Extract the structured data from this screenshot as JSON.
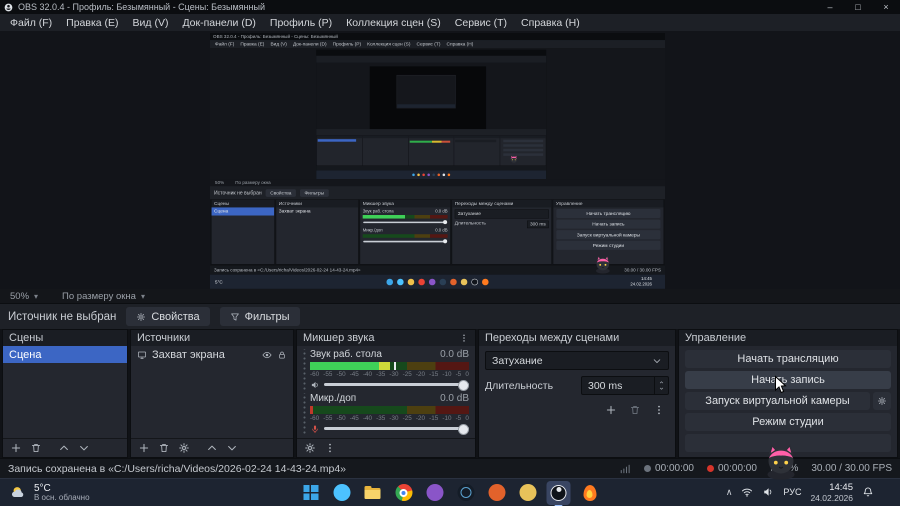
{
  "window": {
    "title": "OBS 32.0.4 - Профиль: Безымянный - Сцены: Безымянный",
    "controls": {
      "minimize": "–",
      "maximize": "□",
      "close": "×"
    }
  },
  "menu": {
    "items": [
      "Файл (F)",
      "Правка (E)",
      "Вид (V)",
      "Док-панели (D)",
      "Профиль (P)",
      "Коллекция сцен (S)",
      "Сервис (T)",
      "Справка (H)"
    ]
  },
  "preview": {
    "zoom": "50%",
    "fit": "По размеру окна"
  },
  "source_row": {
    "status": "Источник не выбран",
    "properties": "Свойства",
    "filters": "Фильтры"
  },
  "scenes": {
    "title": "Сцены",
    "items": [
      {
        "label": "Сцена",
        "selected": true
      }
    ]
  },
  "sources": {
    "title": "Источники",
    "items": [
      {
        "label": "Захват экрана"
      }
    ]
  },
  "mixer": {
    "title": "Микшер звука",
    "channels": [
      {
        "label": "Звук раб. стола",
        "db": "0.0 dB"
      },
      {
        "label": "Микр./доп",
        "db": "0.0 dB"
      }
    ],
    "ticks": [
      "-60",
      "-55",
      "-50",
      "-45",
      "-40",
      "-35",
      "-30",
      "-25",
      "-20",
      "-15",
      "-10",
      "-5",
      "0"
    ]
  },
  "transitions": {
    "title": "Переходы между сценами",
    "selected": "Затухание",
    "duration_label": "Длительность",
    "duration": "300 ms"
  },
  "controls": {
    "title": "Управление",
    "start_stream": "Начать трансляцию",
    "start_record": "Начать запись",
    "virtual_camera": "Запуск виртуальной камеры",
    "studio_mode": "Режим студии",
    "extra_label": ""
  },
  "status": {
    "message": "Запись сохранена в «C:/Users/richa/Videos/2026-02-24 14-43-24.mp4»",
    "stream_time": "00:00:00",
    "record_time": "00:00:00",
    "cpu": "1%",
    "fps": "30.00 / 30.00 FPS"
  },
  "taskbar": {
    "weather_temp": "5°C",
    "weather_desc": "В осн. облачно",
    "language": "РУС",
    "time": "14:45",
    "date": "24.02.2026",
    "pinned_icons": [
      "start",
      "widgets",
      "explorer",
      "chrome",
      "purple-app",
      "steam",
      "orange-app",
      "yellow-app",
      "obs",
      "flame-app"
    ]
  },
  "icons": {
    "properties": "gear-icon",
    "filters": "funnel-icon",
    "add": "plus-icon",
    "remove": "trash-icon",
    "move_up": "chevron-up-icon",
    "move_down": "chevron-down-icon",
    "visibility": "eye-icon",
    "lock": "lock-icon",
    "source_type": "display-icon",
    "volume": "speaker-icon",
    "mic": "microphone-icon",
    "more": "vertical-dots-icon"
  },
  "colors": {
    "selection_blue": "#3c66c4",
    "meter_green": "#3fd158",
    "meter_yellow": "#e6c229",
    "meter_red": "#e0523d",
    "record_red": "#d6342a",
    "taskbar_bg": "#1d2431"
  }
}
